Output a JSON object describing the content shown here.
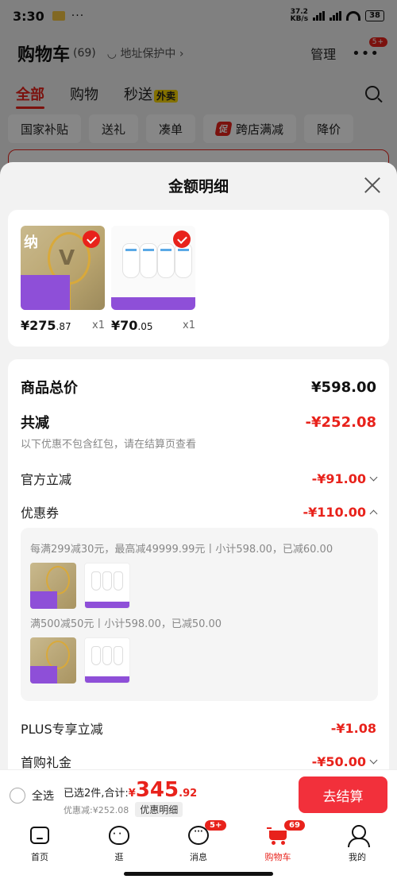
{
  "status_bar": {
    "time": "3:30",
    "dots": "···",
    "net_speed_value": "37.2",
    "net_speed_unit": "KB/s",
    "battery": "38"
  },
  "cart_page": {
    "title": "购物车",
    "count": "(69)",
    "address_protect": "地址保护中",
    "manage": "管理",
    "more_badge": "5+",
    "tabs": [
      {
        "label": "全部"
      },
      {
        "label": "购物"
      },
      {
        "label": "秒送",
        "tag": "外卖"
      }
    ],
    "filters": [
      "国家补贴",
      "送礼",
      "凑单",
      "跨店满减",
      "降价"
    ],
    "promo_mark": "促"
  },
  "sheet": {
    "title": "金额明细",
    "products": [
      {
        "name": "racket",
        "price_int": "¥275",
        "price_dec": ".87",
        "qty": "x1",
        "image_text": "纳"
      },
      {
        "name": "socks",
        "price_int": "¥70",
        "price_dec": ".05",
        "qty": "x1"
      }
    ],
    "rows": {
      "total_label": "商品总价",
      "total_value": "¥598.00",
      "discount_label": "共减",
      "discount_value": "-¥252.08",
      "note": "以下优惠不包含红包，请在结算页查看",
      "official_label": "官方立减",
      "official_value": "-¥91.00",
      "coupon_label": "优惠券",
      "coupon_value": "-¥110.00",
      "plus_label": "PLUS专享立减",
      "plus_value": "-¥1.08",
      "first_label": "首购礼金",
      "first_value": "-¥50.00"
    },
    "coupons": [
      {
        "text": "每满299减30元，最高减49999.99元丨小计598.00，已减60.00"
      },
      {
        "text": "满500减50元丨小计598.00，已减50.00"
      }
    ]
  },
  "checkout": {
    "select_all": "全选",
    "selected_text": "已选2件,合计:",
    "currency": "¥",
    "total_int": "345",
    "total_dec": ".92",
    "discount_text": "优惠减:¥252.08",
    "detail_chip": "优惠明细",
    "button": "去结算"
  },
  "tabbar": [
    {
      "label": "首页"
    },
    {
      "label": "逛"
    },
    {
      "label": "消息",
      "badge": "5+"
    },
    {
      "label": "购物车",
      "badge": "69"
    },
    {
      "label": "我的"
    }
  ],
  "colors": {
    "accent": "#e8221b",
    "checkout_button": "#f2303b",
    "purple": "#8e4fd8"
  }
}
